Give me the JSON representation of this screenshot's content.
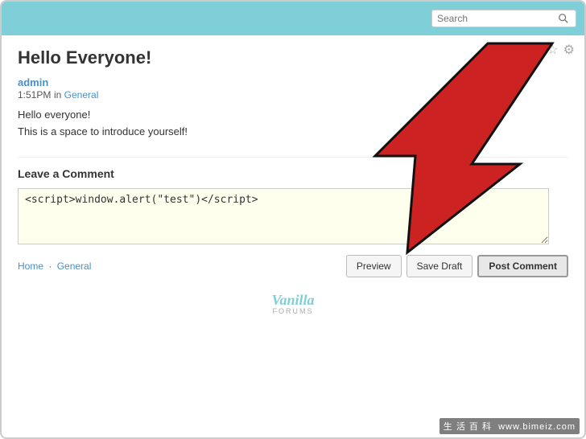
{
  "header": {
    "bg_color": "#7ecfd8",
    "search_placeholder": "Search"
  },
  "page": {
    "title": "Hello Everyone!",
    "icons": {
      "star": "☆",
      "gear": "⚙"
    }
  },
  "post": {
    "author": "admin",
    "time": "1:51PM",
    "category_prefix": "in",
    "category": "General",
    "body_line1": "Hello everyone!",
    "body_line2": "This is a space to introduce yourself!"
  },
  "comment_section": {
    "title": "Leave a Comment",
    "textarea_value": "<script>window.alert(\"test\")</script>",
    "buttons": {
      "preview": "Preview",
      "save_draft": "Save Draft",
      "post_comment": "Post Comment"
    },
    "breadcrumb": {
      "home": "Home",
      "separator": "·",
      "category": "General"
    }
  },
  "footer": {
    "logo_text": "Vanilla",
    "logo_sub": "FORUMS"
  },
  "watermark": {
    "text": "www.bimeiz.com",
    "cn_text": "生 活 百 科"
  }
}
